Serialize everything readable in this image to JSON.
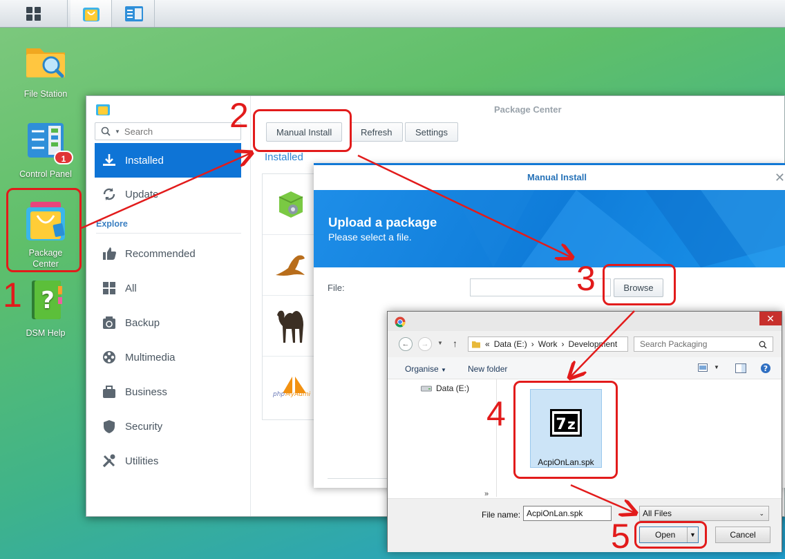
{
  "desktop": {
    "icons": [
      {
        "label": "File Station"
      },
      {
        "label": "Control Panel",
        "badge": "1"
      },
      {
        "label": "Package\nCenter"
      },
      {
        "label": "DSM Help"
      }
    ]
  },
  "package_center": {
    "title": "Package Center",
    "search_placeholder": "Search",
    "nav": {
      "installed": "Installed",
      "update": "Update",
      "explore_heading": "Explore",
      "recommended": "Recommended",
      "all": "All",
      "backup": "Backup",
      "multimedia": "Multimedia",
      "business": "Business",
      "security": "Security",
      "utilities": "Utilities"
    },
    "toolbar": {
      "manual_install": "Manual Install",
      "refresh": "Refresh",
      "settings": "Settings"
    },
    "section_heading": "Installed"
  },
  "manual_install": {
    "title": "Manual Install",
    "banner_title": "Upload a package",
    "banner_subtitle": "Please select a file.",
    "file_label": "File:",
    "file_value": "",
    "browse": "Browse"
  },
  "open_dialog": {
    "breadcrumb": [
      "«",
      "Data (E:)",
      "Work",
      "Development"
    ],
    "search_placeholder": "Search Packaging",
    "toolbar": {
      "organise": "Organise",
      "new_folder": "New folder"
    },
    "tree_item": "Data (E:)",
    "file": {
      "name": "AcpiOnLan.spk",
      "icon_text": "7z"
    },
    "file_name_label": "File name:",
    "file_name_value": "AcpiOnLan.spk",
    "filter": "All Files",
    "open": "Open",
    "cancel": "Cancel"
  },
  "annotations": [
    "1",
    "2",
    "3",
    "4",
    "5"
  ],
  "colors": {
    "accent": "#0e74d6",
    "annotation": "#e21b1b"
  }
}
